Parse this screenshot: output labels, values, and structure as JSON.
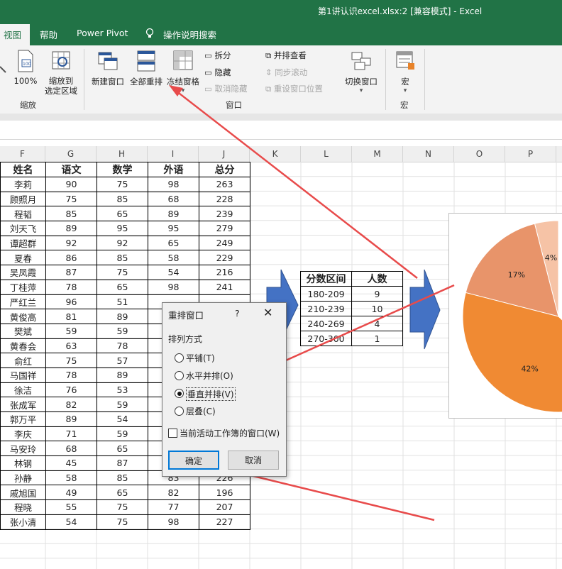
{
  "window": {
    "title": "第1讲认识excel.xlsx:2  [兼容模式]  -  Excel"
  },
  "menu": {
    "items": [
      {
        "label": "视图",
        "active": true
      },
      {
        "label": "帮助"
      },
      {
        "label": "Power Pivot"
      },
      {
        "label": "操作说明搜索",
        "icon": "lightbulb-icon"
      }
    ]
  },
  "ribbon": {
    "zoom": {
      "pct_label": "100%",
      "fit_label": "缩放到\n选定区域",
      "group_label": "缩放"
    },
    "window": {
      "new_window": "新建窗口",
      "arrange_all": "全部重排",
      "freeze": "冻结窗格",
      "split": "拆分",
      "hide": "隐藏",
      "unhide": "取消隐藏",
      "side_by_side": "并排查看",
      "sync_scroll": "同步滚动",
      "reset_pos": "重设窗口位置",
      "switch": "切换窗口",
      "group_label": "窗口"
    },
    "macro": {
      "label": "宏",
      "group_label": "宏"
    }
  },
  "columns": [
    "F",
    "G",
    "H",
    "I",
    "J",
    "K",
    "L",
    "M",
    "N",
    "O",
    "P"
  ],
  "scores": {
    "headers": [
      "姓名",
      "语文",
      "数学",
      "外语",
      "总分"
    ],
    "rows": [
      [
        "李莉",
        "90",
        "75",
        "98",
        "263"
      ],
      [
        "顾照月",
        "75",
        "85",
        "68",
        "228"
      ],
      [
        "程韬",
        "85",
        "65",
        "89",
        "239"
      ],
      [
        "刘天飞",
        "89",
        "95",
        "95",
        "279"
      ],
      [
        "谭超群",
        "92",
        "92",
        "65",
        "249"
      ],
      [
        "夏春",
        "86",
        "85",
        "58",
        "229"
      ],
      [
        "吴凤霞",
        "87",
        "75",
        "54",
        "216"
      ],
      [
        "丁桂萍",
        "78",
        "65",
        "98",
        "241"
      ],
      [
        "严红兰",
        "96",
        "51",
        "",
        ""
      ],
      [
        "黄俊高",
        "81",
        "89",
        "",
        ""
      ],
      [
        "樊斌",
        "59",
        "59",
        "",
        ""
      ],
      [
        "黄春会",
        "63",
        "78",
        "",
        ""
      ],
      [
        "俞红",
        "75",
        "57",
        "",
        ""
      ],
      [
        "马国祥",
        "78",
        "89",
        "",
        ""
      ],
      [
        "徐洁",
        "76",
        "53",
        "",
        ""
      ],
      [
        "张成军",
        "82",
        "59",
        "",
        ""
      ],
      [
        "郭万平",
        "89",
        "54",
        "",
        ""
      ],
      [
        "李庆",
        "71",
        "59",
        "",
        ""
      ],
      [
        "马安玲",
        "68",
        "65",
        "",
        ""
      ],
      [
        "林钢",
        "45",
        "87",
        "86",
        "218"
      ],
      [
        "孙静",
        "58",
        "85",
        "83",
        "226"
      ],
      [
        "戚旭国",
        "49",
        "65",
        "82",
        "196"
      ],
      [
        "程晓",
        "55",
        "75",
        "77",
        "207"
      ],
      [
        "张小清",
        "54",
        "75",
        "98",
        "227"
      ]
    ]
  },
  "ranges": {
    "headers": [
      "分数区间",
      "人数"
    ],
    "rows": [
      [
        "180-209",
        "9"
      ],
      [
        "210-239",
        "10"
      ],
      [
        "240-269",
        "4"
      ],
      [
        "270-300",
        "1"
      ]
    ]
  },
  "chart_data": {
    "type": "pie",
    "labels": [
      "4%",
      "17%",
      "42%"
    ],
    "values": [
      4,
      17,
      42
    ],
    "colors": [
      "#f6c3a6",
      "#e8946a",
      "#f08a33"
    ]
  },
  "dialog": {
    "title": "重排窗口",
    "help": "?",
    "close": "✕",
    "group_label": "排列方式",
    "options": [
      {
        "label": "平铺(T)",
        "selected": false
      },
      {
        "label": "水平并排(O)",
        "selected": false
      },
      {
        "label": "垂直并排(V)",
        "selected": true
      },
      {
        "label": "层叠(C)",
        "selected": false
      }
    ],
    "checkbox": "当前活动工作簿的窗口(W)",
    "ok": "确定",
    "cancel": "取消"
  }
}
